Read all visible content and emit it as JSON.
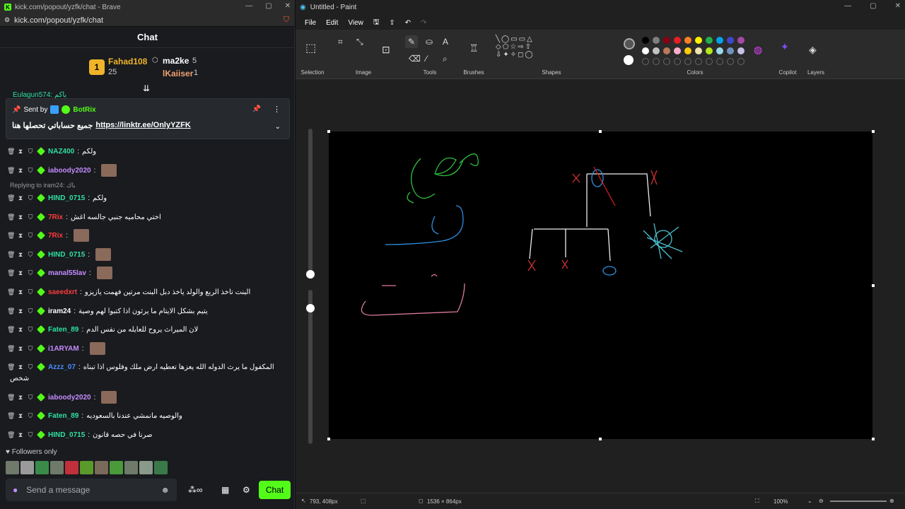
{
  "browser": {
    "title": "kick.com/popout/yzfk/chat - Brave",
    "url": "kick.com/popout/yzfk/chat"
  },
  "chat": {
    "header": "Chat",
    "leaders": [
      {
        "rank": "1",
        "name": "Fahad108",
        "count": "25"
      },
      {
        "name": "ma2ke",
        "count": "5"
      },
      {
        "name": "lKaiiser",
        "count": "1"
      }
    ],
    "pinned": {
      "sent_by_prefix": "Sent by",
      "sender": "BotRix",
      "text": "جميع حساباتي تحصلها هنا",
      "link": "https://linktr.ee/OnlyYZFK",
      "top_user": "Eulagun574: باكم"
    },
    "reply_note": "Replying to iram24: باك",
    "messages": [
      {
        "user": "NAZ400",
        "text": "ولكم",
        "color": "#2fe0a0"
      },
      {
        "user": "iaboody2020",
        "text": "",
        "color": "#c58cff"
      },
      {
        "user": "HIND_0715",
        "text": "ولكم",
        "color": "#2fe0a0"
      },
      {
        "user": "7Rix",
        "text": "اختي محاميه جنبي جالسه اغش",
        "color": "#ff3b3b"
      },
      {
        "user": "7Rix",
        "text": "",
        "color": "#ff3b3b"
      },
      {
        "user": "HIND_0715",
        "text": "",
        "color": "#2fe0a0"
      },
      {
        "user": "manal55lav",
        "text": "",
        "color": "#c58cff"
      },
      {
        "user": "saeedxrt",
        "text": "البنت تاخذ الربع والولد ياخذ دبل البنت مرتين فهمت يازيزو",
        "color": "#ff3b3b"
      },
      {
        "user": "iram24",
        "text": "يتيم بشكل الايتام ما يرثون اذا كتبوا لهم وصية",
        "color": "#ffffff"
      },
      {
        "user": "Faten_89",
        "text": "لان الميراث يروح للعايله من نفس الدم",
        "color": "#2fe0a0"
      },
      {
        "user": "i1ARYAM",
        "text": "",
        "color": "#c58cff"
      },
      {
        "user": "Azzz_07",
        "text": "المكفول ما يرث الدوله الله يعزها تعطيه ارض ملك وفلوس اذا تبناه",
        "text2": "شخص",
        "color": "#4a8cff"
      },
      {
        "user": "iaboody2020",
        "text": "",
        "color": "#c58cff"
      },
      {
        "user": "Faten_89",
        "text": "والوصيه مانمشي عندنا بالسعوديه",
        "color": "#2fe0a0"
      },
      {
        "user": "HIND_0715",
        "text": "صرنا في حصه قانون",
        "color": "#2fe0a0"
      }
    ],
    "followers": "Followers only",
    "placeholder": "Send a message",
    "send": "Chat"
  },
  "paint": {
    "title": "Untitled - Paint",
    "menu": [
      "File",
      "Edit",
      "View"
    ],
    "groups": [
      "Selection",
      "Image",
      "Tools",
      "Brushes",
      "Shapes",
      "Colors",
      "Copilot",
      "Layers"
    ],
    "palette": [
      "#000000",
      "#7f7f7f",
      "#880015",
      "#ed1c24",
      "#ff7f27",
      "#fff200",
      "#22b14c",
      "#00a2e8",
      "#3f48cc",
      "#a349a4",
      "#ffffff",
      "#c3c3c3",
      "#b97a57",
      "#ffaec9",
      "#ffc90e",
      "#efe4b0",
      "#b5e61d",
      "#99d9ea",
      "#7092be",
      "#c8bfe7"
    ],
    "status": {
      "cursor": "793, 408px",
      "size": "1536 × 864px",
      "zoom": "100%"
    }
  }
}
